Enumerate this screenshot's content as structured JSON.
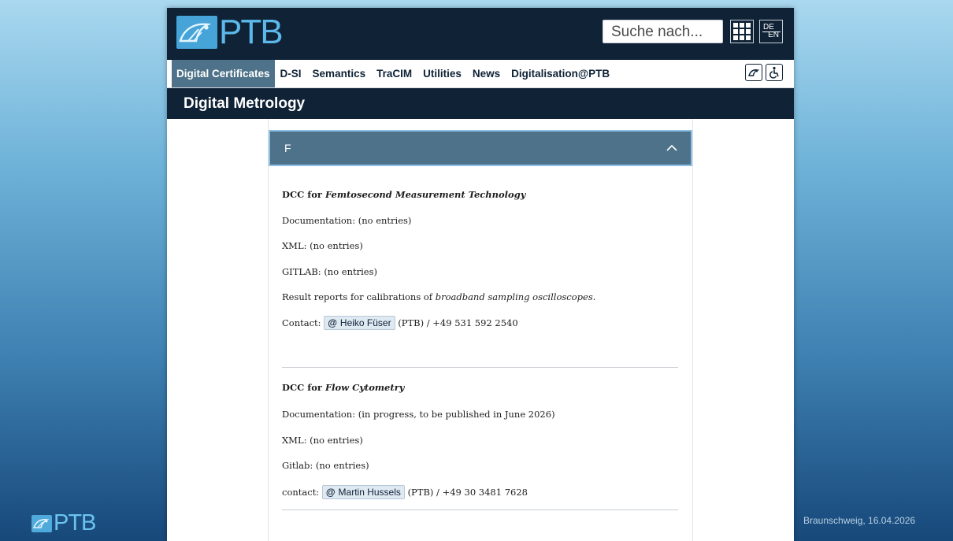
{
  "slide": {
    "logo_text": "PTB",
    "date": "Braunschweig, 16.04.2026"
  },
  "header": {
    "logo_text": "PTB",
    "search_placeholder": "Suche nach...",
    "lang_de": "DE",
    "lang_en": "EN"
  },
  "nav": {
    "items": [
      {
        "label": "Digital Certificates",
        "active": true
      },
      {
        "label": "D-SI"
      },
      {
        "label": "Semantics"
      },
      {
        "label": "TraCIM"
      },
      {
        "label": "Utilities"
      },
      {
        "label": "News"
      },
      {
        "label": "Digitalisation@PTB"
      }
    ],
    "icons": [
      "ptb-eagle-icon",
      "accessibility-icon"
    ]
  },
  "page_title": "Digital Metrology",
  "accordion": {
    "letter": "F",
    "expanded": true
  },
  "entries": [
    {
      "title_prefix": "DCC for ",
      "title_name": "Femtosecond Measurement Technology",
      "documentation": "Documentation: (no entries)",
      "xml": "XML: (no entries)",
      "gitlab": "GITLAB: (no entries)",
      "desc_prefix": "Result reports for calibrations of ",
      "desc_em": "broadband sampling oscilloscopes.",
      "contact_label": "Contact:",
      "contact_at": "@",
      "contact_name": "Heiko Füser",
      "contact_suffix": "(PTB) / +49 531 592 2540"
    },
    {
      "title_prefix": "DCC for ",
      "title_name": "Flow Cytometry",
      "documentation": "Documentation: (in progress, to be published in June 2026)",
      "xml": "XML: (no entries)",
      "gitlab": "Gitlab: (no entries)",
      "contact_label": "contact:",
      "contact_at": "@",
      "contact_name": "Martin Hussels",
      "contact_suffix": "(PTB) / +49 30 3481 7628"
    }
  ]
}
